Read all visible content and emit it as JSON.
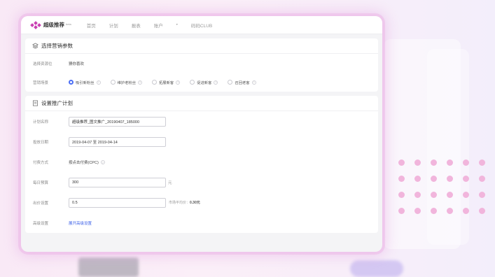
{
  "app": {
    "logo_text": "超级推荐",
    "logo_badge": "beta",
    "brand_color": "#c93fb2",
    "accent_color": "#4b6ef5"
  },
  "nav": {
    "items": [
      {
        "label": "首页"
      },
      {
        "label": "计划"
      },
      {
        "label": "报表"
      },
      {
        "label": "账户"
      },
      {
        "label": "码码CLUB"
      }
    ]
  },
  "section1": {
    "title": "选择营销参数",
    "icon": "layers-icon",
    "rows": {
      "resource_label": "选择资源位",
      "resource_value": "猜你喜欢",
      "scene_label": "营销场景"
    },
    "scenes": [
      {
        "label": "吸引新粉丝",
        "checked": true
      },
      {
        "label": "维护老粉丝",
        "checked": false
      },
      {
        "label": "拓展新客",
        "checked": false
      },
      {
        "label": "促进新客",
        "checked": false
      },
      {
        "label": "召回老客",
        "checked": false
      }
    ]
  },
  "section2": {
    "title": "设置推广计划",
    "icon": "document-icon",
    "plan_name_label": "计划名称",
    "plan_name_value": "超级推荐_图文推广_20190407_185000",
    "date_label": "投放日期",
    "date_value": "2019-04-07 至 2019-04-14",
    "pay_label": "付费方式",
    "pay_value": "按点击付费(CPC)",
    "budget_label": "每日预算",
    "budget_value": "300",
    "budget_unit": "元",
    "bid_label": "出价设置",
    "bid_value": "0.5",
    "bid_hint_prefix": "市场平均价：",
    "bid_hint_value": "0.30元",
    "advanced_label": "高级设置",
    "advanced_link": "展开高级设置"
  }
}
